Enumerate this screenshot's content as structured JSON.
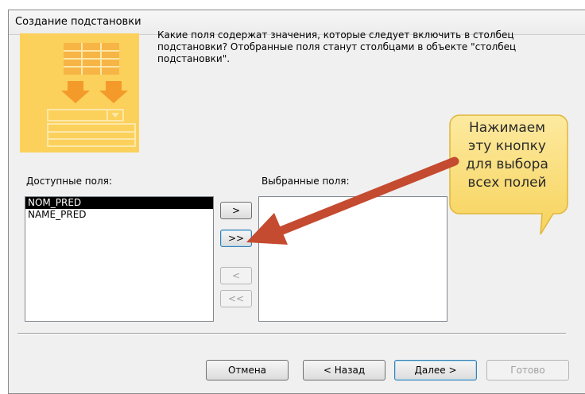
{
  "window": {
    "title": "Создание подстановки"
  },
  "instructions": "Какие поля содержат значения, которые следует включить в столбец подстановки? Отобранные поля станут столбцами в объекте \"столбец подстановки\".",
  "available": {
    "label": "Доступные поля:",
    "items": [
      "NOM_PRED",
      "NAME_PRED"
    ],
    "selected_index": 0
  },
  "selected": {
    "label": "Выбранные поля:",
    "items": []
  },
  "move_buttons": {
    "add_one": ">",
    "add_all": ">>",
    "remove_one": "<",
    "remove_all": "<<"
  },
  "footer": {
    "cancel": "Отмена",
    "back": "< Назад",
    "next": "Далее >",
    "finish": "Готово"
  },
  "annotation": {
    "text_lines": [
      "Нажимаем",
      "эту кнопку",
      "для выбора",
      "всех полей"
    ],
    "color": "#fbe07a",
    "arrow_color": "#c44a30"
  },
  "colors": {
    "graphic": "#fbd15b",
    "graphic_accent": "#f39a2b"
  }
}
